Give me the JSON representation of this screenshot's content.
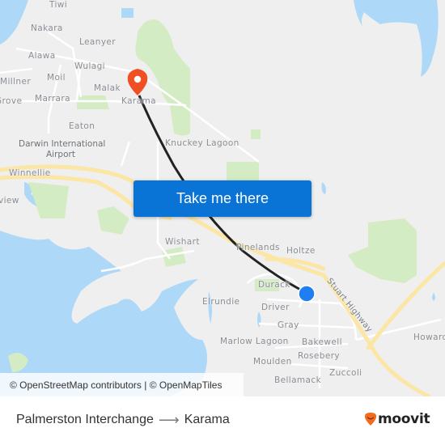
{
  "map": {
    "places": [
      {
        "name": "Tiwi",
        "key": "tiwi"
      },
      {
        "name": "Nakara",
        "key": "nakara"
      },
      {
        "name": "Leanyer",
        "key": "leanyer"
      },
      {
        "name": "Alawa",
        "key": "alawa"
      },
      {
        "name": "Wulagi",
        "key": "wulagi"
      },
      {
        "name": "Millner",
        "key": "millner"
      },
      {
        "name": "Moil",
        "key": "moil"
      },
      {
        "name": "Malak",
        "key": "malak"
      },
      {
        "name": "Grove",
        "key": "grove"
      },
      {
        "name": "Marrara",
        "key": "marrara"
      },
      {
        "name": "Karama",
        "key": "karama"
      },
      {
        "name": "Eaton",
        "key": "eaton"
      },
      {
        "name": "Darwin International",
        "key": "airport-1"
      },
      {
        "name": "Airport",
        "key": "airport-2"
      },
      {
        "name": "Knuckey Lagoon",
        "key": "knuckey-lagoon"
      },
      {
        "name": "Winnellie",
        "key": "winnellie"
      },
      {
        "name": "view",
        "key": "view"
      },
      {
        "name": "Wishart",
        "key": "wishart"
      },
      {
        "name": "Pinelands",
        "key": "pinelands"
      },
      {
        "name": "Holtze",
        "key": "holtze"
      },
      {
        "name": "Durack",
        "key": "durack"
      },
      {
        "name": "Elrundie",
        "key": "elrundie"
      },
      {
        "name": "Driver",
        "key": "driver"
      },
      {
        "name": "Gray",
        "key": "gray"
      },
      {
        "name": "Marlow Lagoon",
        "key": "marlow-lagoon"
      },
      {
        "name": "Bakewell",
        "key": "bakewell"
      },
      {
        "name": "Rosebery",
        "key": "rosebery"
      },
      {
        "name": "Moulden",
        "key": "moulden"
      },
      {
        "name": "Zuccoli",
        "key": "zuccoli"
      },
      {
        "name": "Bellamack",
        "key": "bellamack"
      },
      {
        "name": "Howard",
        "key": "howard"
      }
    ],
    "road_label": "Stuart Highway",
    "origin": "Palmerston Interchange",
    "destination": "Karama",
    "colors": {
      "water": "#aed8f7",
      "park": "#d4ecc4",
      "highway": "#fbe6a6",
      "route": "#222222",
      "destination_pin": "#f04e23",
      "origin_dot": "#1e7ef2"
    }
  },
  "cta": {
    "label": "Take me there"
  },
  "attribution": {
    "text": "© OpenStreetMap contributors | © OpenMapTiles"
  },
  "footer": {
    "origin": "Palmerston Interchange",
    "arrow": "⟶",
    "destination": "Karama",
    "logo_text": "moovit",
    "brand_color": "#f26b21"
  }
}
